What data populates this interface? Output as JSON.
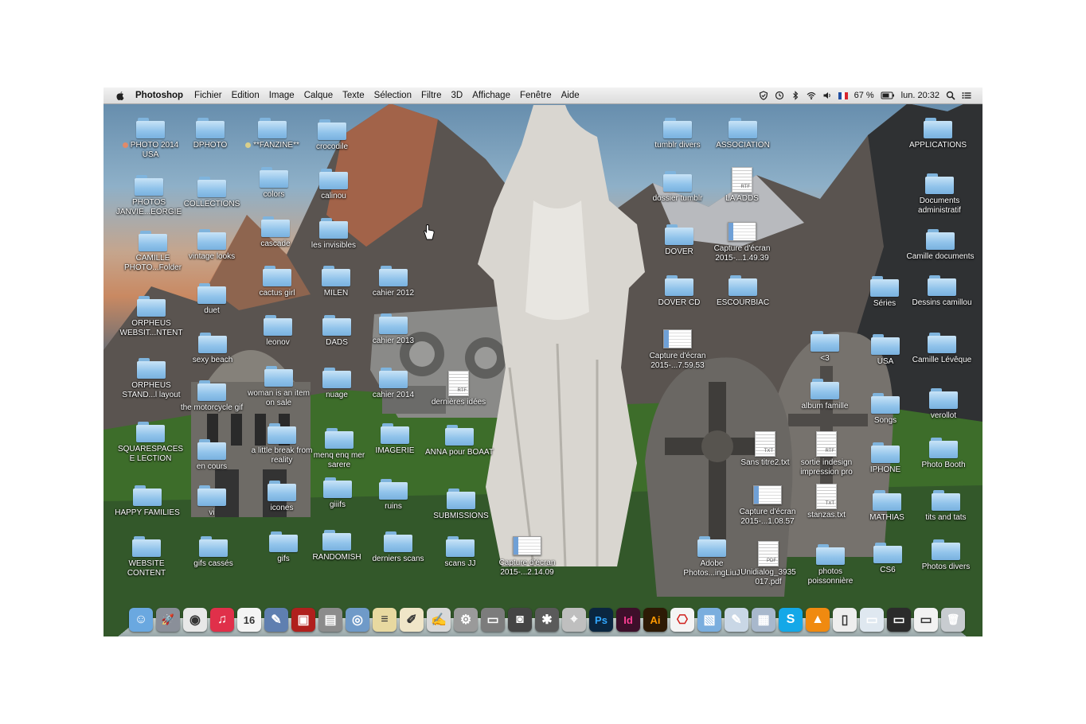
{
  "menubar": {
    "app": "Photoshop",
    "items": [
      "Fichier",
      "Edition",
      "Image",
      "Calque",
      "Texte",
      "Sélection",
      "Filtre",
      "3D",
      "Affichage",
      "Fenêtre",
      "Aide"
    ],
    "battery": "67 %",
    "clock": "lun. 20:32"
  },
  "desktop_items": [
    {
      "label": "PHOTO 2014 USA",
      "kind": "folder",
      "tag": "#e08a6a"
    },
    {
      "label": "DPHOTO",
      "kind": "folder"
    },
    {
      "label": "**FANZINE**",
      "kind": "folder",
      "tag": "#d9cf8a"
    },
    {
      "label": "crocodile",
      "kind": "folder"
    },
    {
      "label": "tumblr divers",
      "kind": "folder"
    },
    {
      "label": "ASSOCIATION",
      "kind": "folder"
    },
    {
      "label": "APPLICATIONS",
      "kind": "folder"
    },
    {
      "label": "PHOTOS JANVIE...EORGIE",
      "kind": "folder"
    },
    {
      "label": "COLLECTIONS",
      "kind": "folder"
    },
    {
      "label": "colors",
      "kind": "folder"
    },
    {
      "label": "calinou",
      "kind": "folder"
    },
    {
      "label": "dossier tumblr",
      "kind": "folder"
    },
    {
      "label": "LA ADDS",
      "kind": "doc",
      "ext": "RTF"
    },
    {
      "label": "Documents administratif",
      "kind": "folder"
    },
    {
      "label": "CAMILLE PHOTO...Folder",
      "kind": "folder"
    },
    {
      "label": "vintage looks",
      "kind": "folder"
    },
    {
      "label": "cascade",
      "kind": "folder"
    },
    {
      "label": "les invisibles",
      "kind": "folder"
    },
    {
      "label": "DOVER",
      "kind": "folder"
    },
    {
      "label": "Capture d'écran 2015-...1.49.39",
      "kind": "shot"
    },
    {
      "label": "Camille documents",
      "kind": "folder"
    },
    {
      "label": "duet",
      "kind": "folder"
    },
    {
      "label": "cactus girl",
      "kind": "folder"
    },
    {
      "label": "MILEN",
      "kind": "folder"
    },
    {
      "label": "cahier 2012",
      "kind": "folder"
    },
    {
      "label": "DOVER CD",
      "kind": "folder"
    },
    {
      "label": "ESCOURBIAC",
      "kind": "folder"
    },
    {
      "label": "Séries",
      "kind": "folder"
    },
    {
      "label": "Dessins camillou",
      "kind": "folder"
    },
    {
      "label": "ORPHEUS WEBSIT...NTENT",
      "kind": "folder"
    },
    {
      "label": "leonov",
      "kind": "folder"
    },
    {
      "label": "DADS",
      "kind": "folder"
    },
    {
      "label": "cahier 2013",
      "kind": "folder"
    },
    {
      "label": "Capture d'écran 2015-...7.59.53",
      "kind": "shot"
    },
    {
      "label": "<3",
      "kind": "folder"
    },
    {
      "label": "USA",
      "kind": "folder"
    },
    {
      "label": "Camille Lévêque",
      "kind": "folder"
    },
    {
      "label": "sexy beach",
      "kind": "folder"
    },
    {
      "label": "ORPHEUS STAND...l layout",
      "kind": "folder"
    },
    {
      "label": "woman is an item on sale",
      "kind": "folder"
    },
    {
      "label": "nuage",
      "kind": "folder"
    },
    {
      "label": "cahier 2014",
      "kind": "folder"
    },
    {
      "label": "dernières idées",
      "kind": "doc",
      "ext": "RTF"
    },
    {
      "label": "album famille",
      "kind": "folder"
    },
    {
      "label": "Songs",
      "kind": "folder"
    },
    {
      "label": "verollot",
      "kind": "folder"
    },
    {
      "label": "the motorcycle gif",
      "kind": "folder"
    },
    {
      "label": "SQUARESPACESE LECTION",
      "kind": "folder"
    },
    {
      "label": "a little break from reality",
      "kind": "folder"
    },
    {
      "label": "menq enq mer sarere",
      "kind": "folder"
    },
    {
      "label": "IMAGERIE",
      "kind": "folder"
    },
    {
      "label": "ANNA pour BOAAT",
      "kind": "folder"
    },
    {
      "label": "Sans titre2.txt",
      "kind": "doc",
      "ext": "TXT"
    },
    {
      "label": "sortie indesign impression pro",
      "kind": "doc",
      "ext": "RTF"
    },
    {
      "label": "IPHONE",
      "kind": "folder"
    },
    {
      "label": "Photo Booth",
      "kind": "folder"
    },
    {
      "label": "en cours",
      "kind": "folder"
    },
    {
      "label": "HAPPY FAMILIES",
      "kind": "folder"
    },
    {
      "label": "vi",
      "kind": "folder"
    },
    {
      "label": "icones",
      "kind": "folder"
    },
    {
      "label": "giiifs",
      "kind": "folder"
    },
    {
      "label": "ruins",
      "kind": "folder"
    },
    {
      "label": "SUBMISSIONS",
      "kind": "folder"
    },
    {
      "label": "Capture d'écran 2015-...1.08.57",
      "kind": "shot"
    },
    {
      "label": "stanzas.txt",
      "kind": "doc",
      "ext": "TXT"
    },
    {
      "label": "MATHIAS",
      "kind": "folder"
    },
    {
      "label": "tits and tats",
      "kind": "folder"
    },
    {
      "label": "WEBSITE CONTENT",
      "kind": "folder"
    },
    {
      "label": "gifs cassés",
      "kind": "folder"
    },
    {
      "label": "gifs",
      "kind": "folder"
    },
    {
      "label": "RANDOMISH",
      "kind": "folder"
    },
    {
      "label": "derniers scans",
      "kind": "folder"
    },
    {
      "label": "scans JJ",
      "kind": "folder"
    },
    {
      "label": "Capture d'écran 2015-...2.14.09",
      "kind": "shot"
    },
    {
      "label": "Adobe Photos...ingLiuJ",
      "kind": "folder"
    },
    {
      "label": "Unidialog_3935 017.pdf",
      "kind": "doc",
      "ext": "PDF"
    },
    {
      "label": "photos poissonnière",
      "kind": "folder"
    },
    {
      "label": "CS6",
      "kind": "folder"
    },
    {
      "label": "Photos divers",
      "kind": "folder"
    }
  ],
  "dock": [
    {
      "name": "finder",
      "color": "#6aa8e0",
      "glyph": "☺"
    },
    {
      "name": "launchpad",
      "color": "#8a8f99",
      "glyph": "🚀"
    },
    {
      "name": "chrome",
      "color": "#e8e8e8",
      "glyph": "◉"
    },
    {
      "name": "itunes",
      "color": "#e0304a",
      "glyph": "♫"
    },
    {
      "name": "calendar",
      "color": "#f4f4f4",
      "glyph": "16"
    },
    {
      "name": "preview",
      "color": "#5f7fb0",
      "glyph": "✎"
    },
    {
      "name": "photo-booth",
      "color": "#b0201d",
      "glyph": "▣"
    },
    {
      "name": "iphoto",
      "color": "#8c8c8c",
      "glyph": "▤"
    },
    {
      "name": "image-capture",
      "color": "#6f9ac8",
      "glyph": "◎"
    },
    {
      "name": "notes",
      "color": "#e8d9a0",
      "glyph": "≡"
    },
    {
      "name": "textedit",
      "color": "#f0e6c8",
      "glyph": "✐"
    },
    {
      "name": "pages",
      "color": "#d8d8d8",
      "glyph": "✍"
    },
    {
      "name": "system-preferences",
      "color": "#9a9a9a",
      "glyph": "⚙"
    },
    {
      "name": "monitor",
      "color": "#7c7c7c",
      "glyph": "▭"
    },
    {
      "name": "camera",
      "color": "#444",
      "glyph": "◙"
    },
    {
      "name": "color-picker",
      "color": "#5a5a5a",
      "glyph": "✱"
    },
    {
      "name": "screenshot",
      "color": "#bfbfbf",
      "glyph": "⌖"
    },
    {
      "name": "photoshop",
      "color": "#0a2640",
      "glyph": "Ps",
      "fg": "#31a8ff"
    },
    {
      "name": "indesign",
      "color": "#3d0f2a",
      "glyph": "Id",
      "fg": "#ff3f94"
    },
    {
      "name": "illustrator",
      "color": "#2d1a05",
      "glyph": "Ai",
      "fg": "#ff9a00"
    },
    {
      "name": "acrobat",
      "color": "#f4f4f4",
      "glyph": "⎔",
      "fg": "#d0201c"
    },
    {
      "name": "photos",
      "color": "#7aaede",
      "glyph": "▧"
    },
    {
      "name": "text-editor",
      "color": "#c9d7e6",
      "glyph": "✎"
    },
    {
      "name": "photo-library",
      "color": "#a8b8cc",
      "glyph": "▦"
    },
    {
      "name": "skype",
      "color": "#14a8e8",
      "glyph": "S"
    },
    {
      "name": "vlc",
      "color": "#f08a10",
      "glyph": "▲"
    },
    {
      "name": "pdf-stack",
      "color": "#eeeeee",
      "glyph": "▯"
    },
    {
      "name": "skype-window",
      "color": "#dfe8f0",
      "glyph": "▭"
    },
    {
      "name": "ps-window",
      "color": "#2b2b2b",
      "glyph": "▭"
    },
    {
      "name": "chrome-window",
      "color": "#f2f2f2",
      "glyph": "▭"
    },
    {
      "name": "trash",
      "color": "#c8ccd0",
      "glyph": "🗑"
    }
  ]
}
